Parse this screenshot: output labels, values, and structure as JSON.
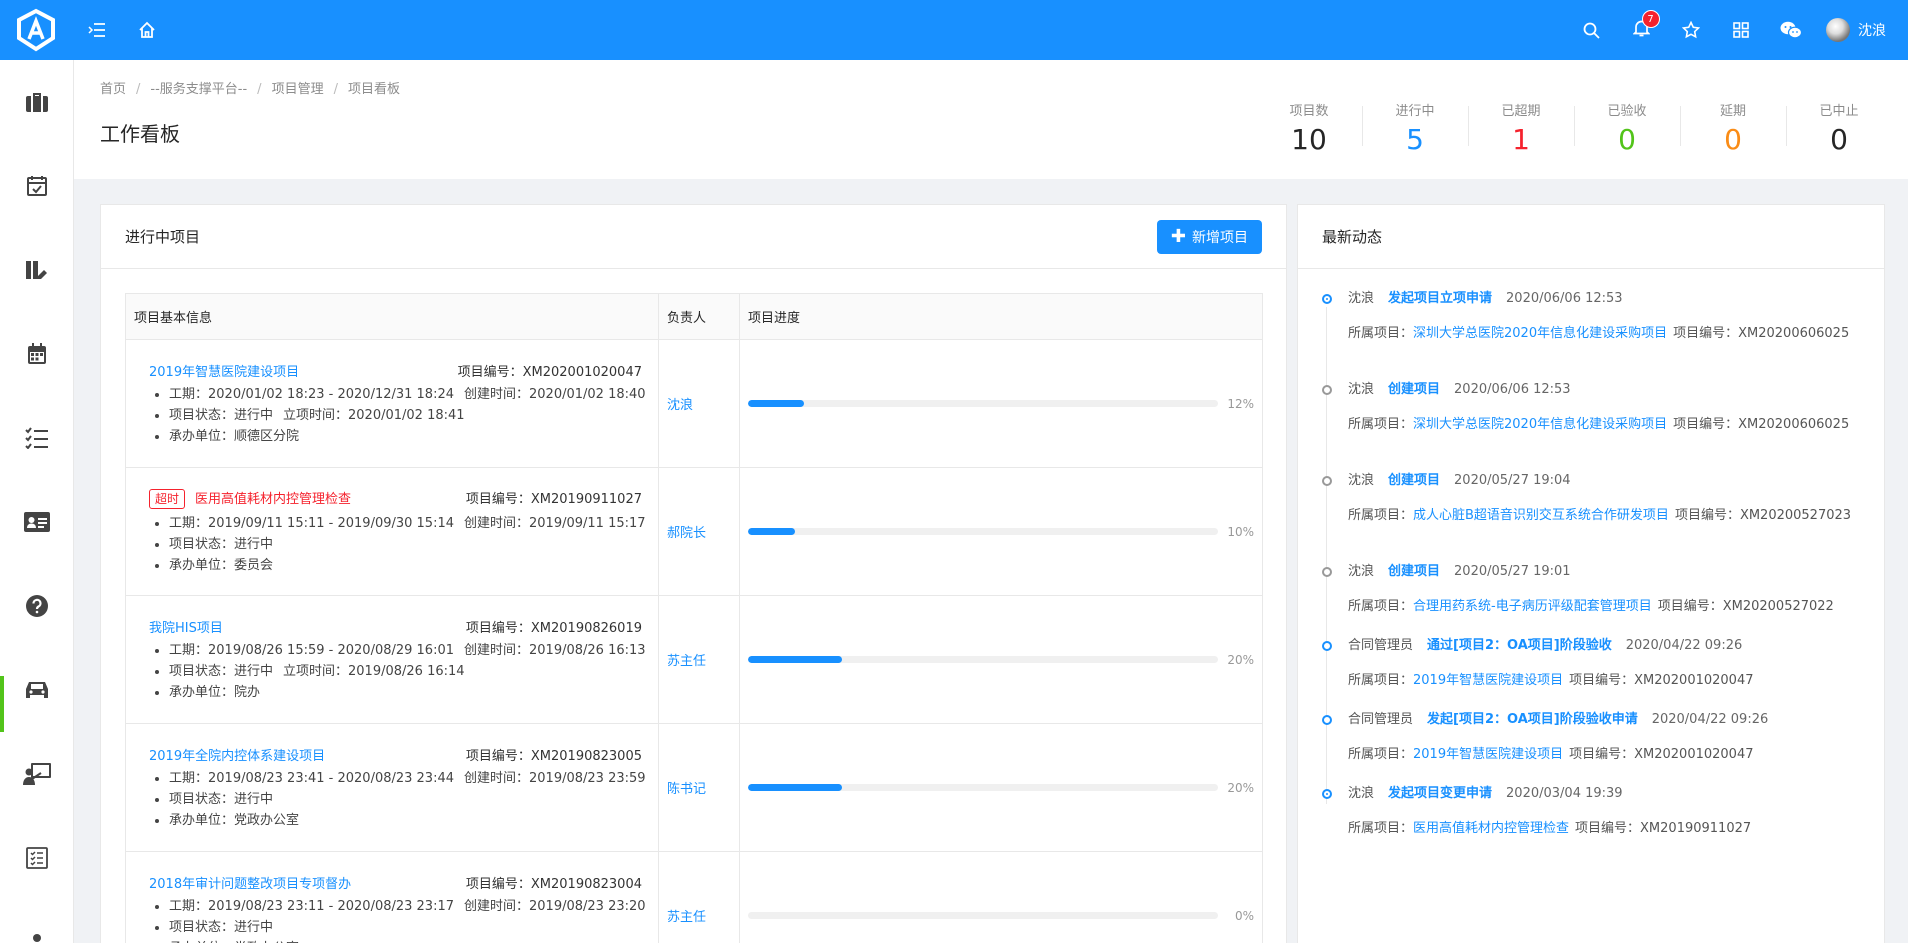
{
  "header": {
    "notification_count": "7",
    "user_name": "沈浪"
  },
  "breadcrumb": [
    "首页",
    "--服务支撑平台--",
    "项目管理",
    "项目看板"
  ],
  "page_title": "工作看板",
  "stats": [
    {
      "label": "项目数",
      "value": "10",
      "color": "#262626"
    },
    {
      "label": "进行中",
      "value": "5",
      "color": "#1890ff"
    },
    {
      "label": "已超期",
      "value": "1",
      "color": "#f5222d"
    },
    {
      "label": "已验收",
      "value": "0",
      "color": "#52c41a"
    },
    {
      "label": "延期",
      "value": "0",
      "color": "#fa8c16"
    },
    {
      "label": "已中止",
      "value": "0",
      "color": "#262626"
    }
  ],
  "projects_card": {
    "title": "进行中项目",
    "new_button": "新增项目",
    "columns": [
      "项目基本信息",
      "负责人",
      "项目进度"
    ],
    "rows": [
      {
        "name": "2019年智慧医院建设项目",
        "code": "项目编号：XM202001020047",
        "overdue": false,
        "tag": "",
        "lines": [
          [
            "工期：2020/01/02 18:23 - 2020/12/31 18:24",
            "创建时间：2020/01/02 18:40"
          ],
          [
            "项目状态：进行中",
            "立项时间：2020/01/02 18:41"
          ],
          [
            "承办单位：顺德区分院"
          ]
        ],
        "owner": "沈浪",
        "progress": 12,
        "progress_label": "12%"
      },
      {
        "name": "医用高值耗材内控管理检查",
        "code": "项目编号：XM20190911027",
        "overdue": true,
        "tag": "超时",
        "lines": [
          [
            "工期：2019/09/11 15:11 - 2019/09/30 15:14",
            "创建时间：2019/09/11 15:17"
          ],
          [
            "项目状态：进行中"
          ],
          [
            "承办单位：委员会"
          ]
        ],
        "owner": "郝院长",
        "progress": 10,
        "progress_label": "10%"
      },
      {
        "name": "我院HIS项目",
        "code": "项目编号：XM20190826019",
        "overdue": false,
        "tag": "",
        "lines": [
          [
            "工期：2019/08/26 15:59 - 2020/08/29 16:01",
            "创建时间：2019/08/26 16:13"
          ],
          [
            "项目状态：进行中",
            "立项时间：2019/08/26 16:14"
          ],
          [
            "承办单位：院办"
          ]
        ],
        "owner": "苏主任",
        "progress": 20,
        "progress_label": "20%"
      },
      {
        "name": "2019年全院内控体系建设项目",
        "code": "项目编号：XM20190823005",
        "overdue": false,
        "tag": "",
        "lines": [
          [
            "工期：2019/08/23 23:41 - 2020/08/23 23:44",
            "创建时间：2019/08/23 23:59"
          ],
          [
            "项目状态：进行中"
          ],
          [
            "承办单位：党政办公室"
          ]
        ],
        "owner": "陈书记",
        "progress": 20,
        "progress_label": "20%"
      },
      {
        "name": "2018年审计问题整改项目专项督办",
        "code": "项目编号：XM20190823004",
        "overdue": false,
        "tag": "",
        "lines": [
          [
            "工期：2019/08/23 23:11 - 2020/08/23 23:17",
            "创建时间：2019/08/23 23:20"
          ],
          [
            "项目状态：进行中"
          ],
          [
            "承办单位：党政办公室"
          ]
        ],
        "owner": "苏主任",
        "progress": 0,
        "progress_label": "0%"
      }
    ]
  },
  "activity_card": {
    "title": "最新动态",
    "items": [
      {
        "user": "沈浪",
        "action": "发起项目立项申请",
        "time": "2020/06/06 12:53",
        "filled": true,
        "label": "所属项目：",
        "project": "深圳大学总医院2020年信息化建设采购项目",
        "code": "项目编号：XM20200606025"
      },
      {
        "user": "沈浪",
        "action": "创建项目",
        "time": "2020/06/06 12:53",
        "filled": false,
        "label": "所属项目：",
        "project": "深圳大学总医院2020年信息化建设采购项目",
        "code": "项目编号：XM20200606025"
      },
      {
        "user": "沈浪",
        "action": "创建项目",
        "time": "2020/05/27 19:04",
        "filled": false,
        "label": "所属项目：",
        "project": "成人心脏B超语音识别交互系统合作研发项目",
        "code": "项目编号：XM20200527023"
      },
      {
        "user": "沈浪",
        "action": "创建项目",
        "time": "2020/05/27 19:01",
        "filled": false,
        "label": "所属项目：",
        "project": "合理用药系统-电子病历评级配套管理项目",
        "code": "项目编号：XM20200527022"
      },
      {
        "user": "合同管理员",
        "action": "通过[项目2：OA项目]阶段验收",
        "time": "2020/04/22 09:26",
        "filled": false,
        "label": "所属项目：",
        "project": "2019年智慧医院建设项目",
        "code": "项目编号：XM202001020047"
      },
      {
        "user": "合同管理员",
        "action": "发起[项目2：OA项目]阶段验收申请",
        "time": "2020/04/22 09:26",
        "filled": false,
        "label": "所属项目：",
        "project": "2019年智慧医院建设项目",
        "code": "项目编号：XM202001020047"
      },
      {
        "user": "沈浪",
        "action": "发起项目变更申请",
        "time": "2020/03/04 19:39",
        "filled": true,
        "label": "所属项目：",
        "project": "医用高值耗材内控管理检查",
        "code": "项目编号：XM20190911027"
      }
    ]
  }
}
